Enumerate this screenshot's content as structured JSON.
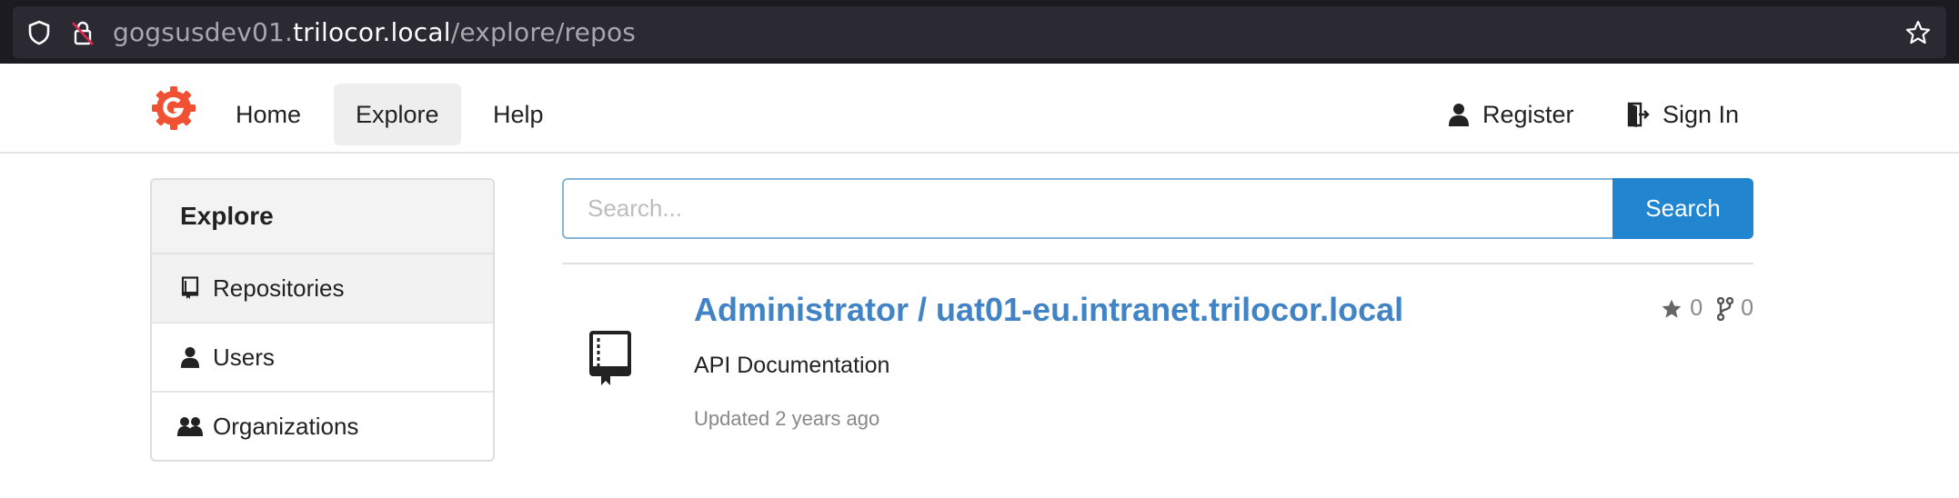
{
  "browser": {
    "url_prefix": "gogsusdev01.",
    "url_host": "trilocor.local",
    "url_path": "/explore/repos"
  },
  "nav": {
    "home": "Home",
    "explore": "Explore",
    "help": "Help",
    "register": "Register",
    "sign_in": "Sign In"
  },
  "sidebar": {
    "title": "Explore",
    "items": [
      {
        "label": "Repositories",
        "icon": "repo-icon",
        "active": true
      },
      {
        "label": "Users",
        "icon": "user-icon",
        "active": false
      },
      {
        "label": "Organizations",
        "icon": "organization-icon",
        "active": false
      }
    ]
  },
  "search": {
    "placeholder": "Search...",
    "button": "Search"
  },
  "repos": [
    {
      "title": "Administrator / uat01-eu.intranet.trilocor.local",
      "stars": "0",
      "forks": "0",
      "description": "API Documentation",
      "updated": "Updated 2 years ago"
    }
  ],
  "colors": {
    "accent": "#2185d0",
    "link": "#4183c4",
    "logo": "#f05133"
  }
}
